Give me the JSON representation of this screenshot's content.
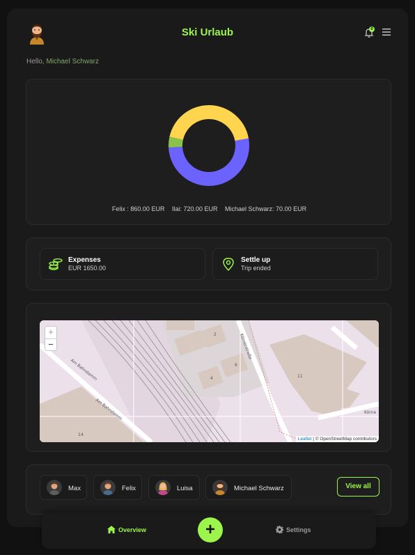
{
  "header": {
    "title": "Ski Urlaub",
    "notification_count": "0",
    "avatar_icon": "bearded-man-avatar-icon",
    "bell_icon": "bell-icon",
    "menu_icon": "hamburger-menu-icon"
  },
  "greeting": {
    "prefix": "Hello,",
    "user_name": "Michael Schwarz"
  },
  "chart_data": {
    "type": "pie",
    "donut": true,
    "series": [
      {
        "name": "Felix",
        "value": 860.0,
        "color": "#6c63ff"
      },
      {
        "name": "Ilai",
        "value": 720.0,
        "color": "#ffd54f"
      },
      {
        "name": "Michael Schwarz",
        "value": 70.0,
        "color": "#8bc34a"
      }
    ],
    "legend": [
      "Felix : 860.00 EUR",
      "Ilai: 720.00 EUR",
      "Michael Schwarz: 70.00 EUR"
    ]
  },
  "stats": {
    "expenses": {
      "title": "Expenses",
      "value": "EUR 1650.00",
      "icon": "coins-icon"
    },
    "settle": {
      "title": "Settle up",
      "value": "Trip ended",
      "icon": "location-pin-icon"
    }
  },
  "map": {
    "zoom_in": "+",
    "zoom_out": "−",
    "attribution_link": "Leaflet",
    "attribution_text": "| © OpenStreetMap contributors",
    "street_labels": [
      "Am Bahndamm",
      "Am Bahndamm",
      "Körnerstraße",
      "Körne"
    ],
    "numbers": [
      "2",
      "4",
      "6",
      "11",
      "14"
    ]
  },
  "people": {
    "members": [
      {
        "name": "Max",
        "avatar": "man-avatar-icon"
      },
      {
        "name": "Felix",
        "avatar": "man-avatar-icon"
      },
      {
        "name": "Luisa",
        "avatar": "woman-avatar-icon"
      },
      {
        "name": "Michael Schwarz",
        "avatar": "bearded-man-avatar-icon"
      }
    ],
    "view_all": "View all"
  },
  "nav": {
    "overview": "Overview",
    "settings": "Settings",
    "add": "+"
  },
  "colors": {
    "accent": "#9cf54a",
    "background": "#111111",
    "card": "#1e1e1e"
  }
}
